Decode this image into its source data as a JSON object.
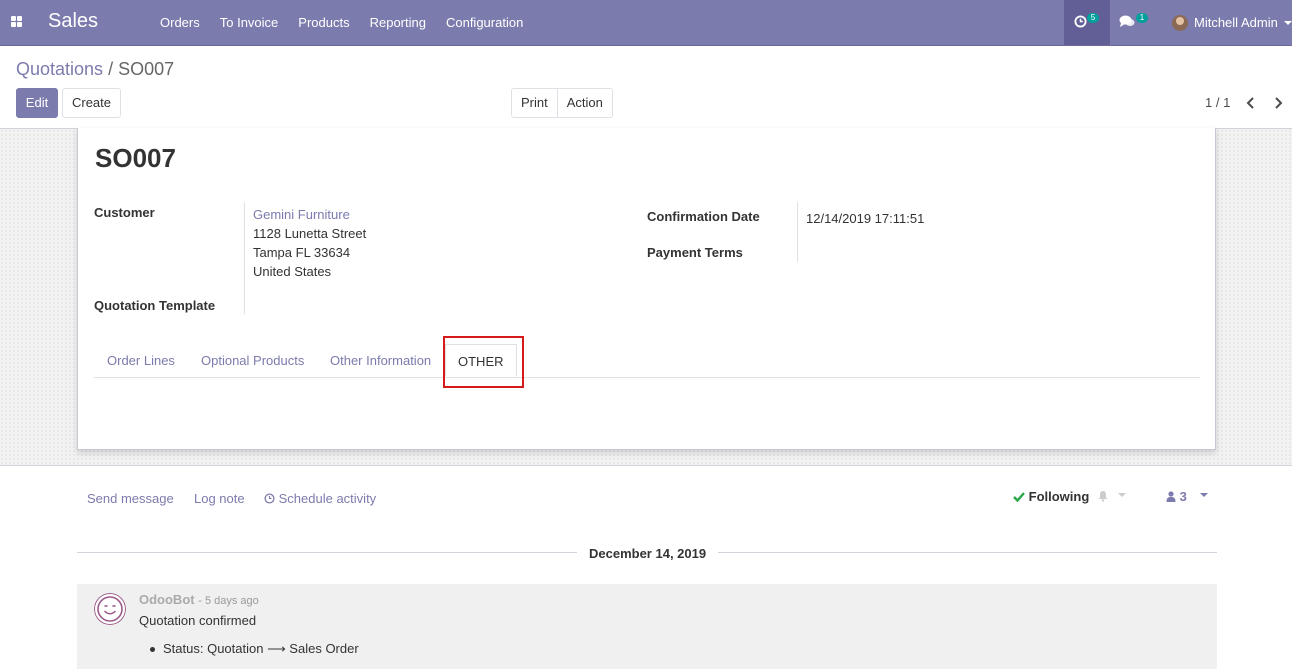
{
  "navbar": {
    "app_name": "Sales",
    "menu": [
      "Orders",
      "To Invoice",
      "Products",
      "Reporting",
      "Configuration"
    ],
    "activity_count": "5",
    "message_count": "1",
    "user_name": "Mitchell Admin",
    "brand_color": "#7c7bad"
  },
  "control_panel": {
    "breadcrumb_parent": "Quotations",
    "breadcrumb_separator": "/",
    "breadcrumb_current": "SO007",
    "edit_label": "Edit",
    "create_label": "Create",
    "print_label": "Print",
    "action_label": "Action",
    "pager": "1 / 1"
  },
  "form": {
    "name": "SO007",
    "customer_label": "Customer",
    "customer_name": "Gemini Furniture",
    "address_line1": "1128 Lunetta Street",
    "address_line2": "Tampa FL 33634",
    "address_line3": "United States",
    "template_label": "Quotation Template",
    "confirmation_label": "Confirmation Date",
    "confirmation_value": "12/14/2019 17:11:51",
    "payment_terms_label": "Payment Terms",
    "tabs": [
      "Order Lines",
      "Optional Products",
      "Other Information",
      "OTHER"
    ],
    "active_tab": "OTHER",
    "highlight_color": "#d61a1a"
  },
  "chatter": {
    "send_message": "Send message",
    "log_note": "Log note",
    "schedule_activity": "Schedule activity",
    "following": "Following",
    "followers_count": "3",
    "date": "December 14, 2019",
    "message": {
      "author": "OdooBot",
      "time_ago": "- 5 days ago",
      "body": "Quotation confirmed",
      "tracking": "Status: Quotation ⟶ Sales Order"
    }
  }
}
